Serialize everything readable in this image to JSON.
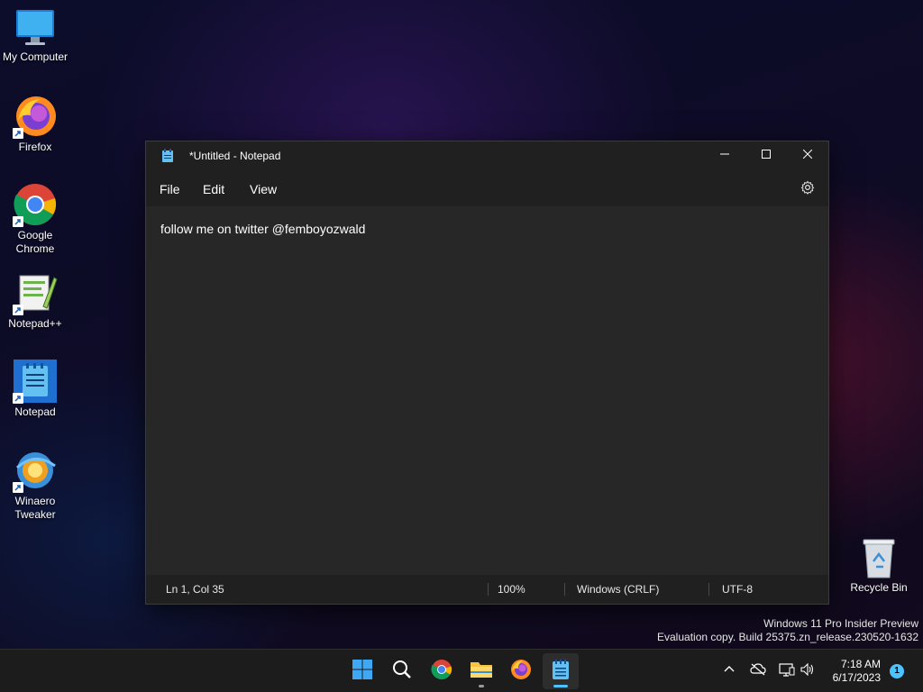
{
  "desktop": {
    "icons": [
      {
        "label": "My Computer"
      },
      {
        "label": "Firefox"
      },
      {
        "label": "Google Chrome"
      },
      {
        "label": "Notepad++"
      },
      {
        "label": "Notepad"
      },
      {
        "label": "Winaero Tweaker"
      },
      {
        "label": "Recycle Bin"
      }
    ],
    "watermark": {
      "line1": "Windows 11 Pro Insider Preview",
      "line2": "Evaluation copy. Build 25375.zn_release.230520-1632"
    }
  },
  "notepad": {
    "title": "*Untitled - Notepad",
    "menu": {
      "file": "File",
      "edit": "Edit",
      "view": "View"
    },
    "content": "follow me on twitter @femboyozwald",
    "status": {
      "position": "Ln 1, Col 35",
      "zoom": "100%",
      "line_ending": "Windows (CRLF)",
      "encoding": "UTF-8"
    }
  },
  "taskbar": {
    "apps": [
      "windows-start",
      "search",
      "chrome",
      "file-explorer",
      "firefox",
      "notepad"
    ],
    "clock": {
      "time": "7:18 AM",
      "date": "6/17/2023"
    },
    "notification_count": "1"
  },
  "colors": {
    "accent": "#4cc2ff",
    "window_bg": "#272727",
    "chrome_bg": "#202020",
    "taskbar_bg": "#1c1c1c"
  }
}
